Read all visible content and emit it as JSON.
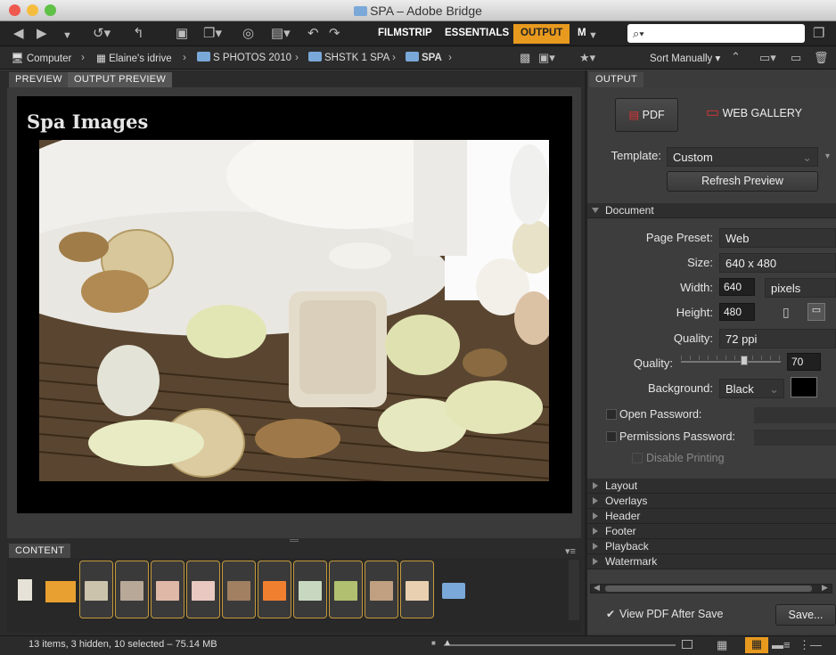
{
  "window": {
    "title": "SPA – Adobe Bridge"
  },
  "toolbar": {
    "workspaces": [
      "FILMSTRIP",
      "ESSENTIALS",
      "OUTPUT",
      "M"
    ],
    "search_value": "⌕▾"
  },
  "path": {
    "items": [
      "Computer",
      "Elaine's idrive",
      "S PHOTOS 2010",
      "SHSTK 1 SPA",
      "SPA"
    ],
    "sort_label": "Sort Manually"
  },
  "preview": {
    "tabs": [
      "PREVIEW",
      "OUTPUT PREVIEW"
    ],
    "page_title": "Spa Images"
  },
  "content": {
    "tab": "CONTENT",
    "thumb_colors": [
      "#d9d4c8",
      "#e8a030",
      "#c8c0a8",
      "#b8a898",
      "#e0b8a8",
      "#e8c8c0",
      "#a08060",
      "#f08030",
      "#c8d8c0",
      "#b0c070",
      "#c0a080",
      "#e8d0b0"
    ]
  },
  "status": {
    "text": "13 items, 3 hidden, 10 selected – 75.14 MB"
  },
  "output": {
    "tab": "OUTPUT",
    "pdf_label": "PDF",
    "web_gallery_label": "WEB GALLERY",
    "template_label": "Template:",
    "template_value": "Custom",
    "refresh_label": "Refresh Preview",
    "document_header": "Document",
    "page_preset_label": "Page Preset:",
    "page_preset_value": "Web",
    "size_label": "Size:",
    "size_value": "640 x 480",
    "width_label": "Width:",
    "width_value": "640",
    "units_value": "pixels",
    "height_label": "Height:",
    "height_value": "480",
    "quality_label": "Quality:",
    "quality_value": "72 ppi",
    "quality2_label": "Quality:",
    "quality2_value": "70",
    "background_label": "Background:",
    "background_value": "Black",
    "open_password_label": "Open Password:",
    "permissions_password_label": "Permissions Password:",
    "disable_printing_label": "Disable Printing",
    "sections": [
      "Layout",
      "Overlays",
      "Header",
      "Footer",
      "Playback",
      "Watermark"
    ],
    "view_pdf_label": "View PDF After Save",
    "save_label": "Save..."
  },
  "colors": {
    "accent": "#e89a1e",
    "panel": "#3d3d3d"
  }
}
